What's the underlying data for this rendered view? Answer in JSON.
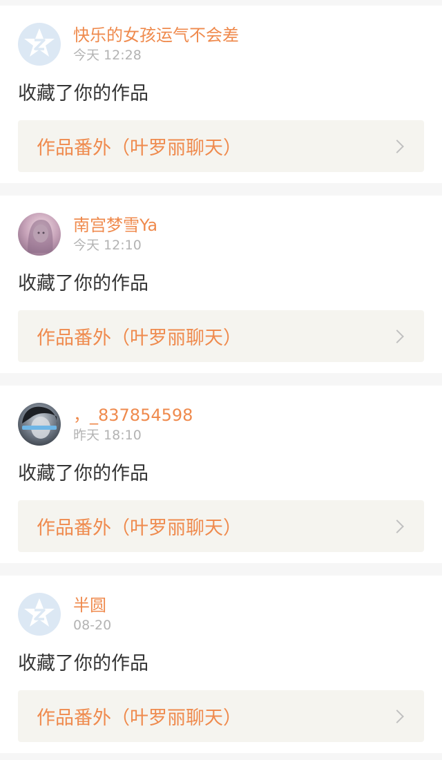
{
  "notifications": [
    {
      "username": "快乐的女孩运气不会差",
      "time": "今天 12:28",
      "action": "收藏了你的作品",
      "work_title": "作品番外（叶罗丽聊天）",
      "avatar": "default-star-avatar"
    },
    {
      "username": "南宫梦雪Ya",
      "time": "今天 12:10",
      "action": "收藏了你的作品",
      "work_title": "作品番外（叶罗丽聊天）",
      "avatar": "anime-girl-avatar"
    },
    {
      "username": "，_837854598",
      "time": "昨天 18:10",
      "action": "收藏了你的作品",
      "work_title": "作品番外（叶罗丽聊天）",
      "avatar": "photo-avatar"
    },
    {
      "username": "半圆",
      "time": "08-20",
      "action": "收藏了你的作品",
      "work_title": "作品番外（叶罗丽聊天）",
      "avatar": "default-star-avatar"
    }
  ],
  "colors": {
    "accent": "#ef8a4d",
    "muted": "#b3b3b3",
    "text": "#333333",
    "work_box_bg": "#f5f4ef",
    "page_bg": "#f6f6f6"
  }
}
